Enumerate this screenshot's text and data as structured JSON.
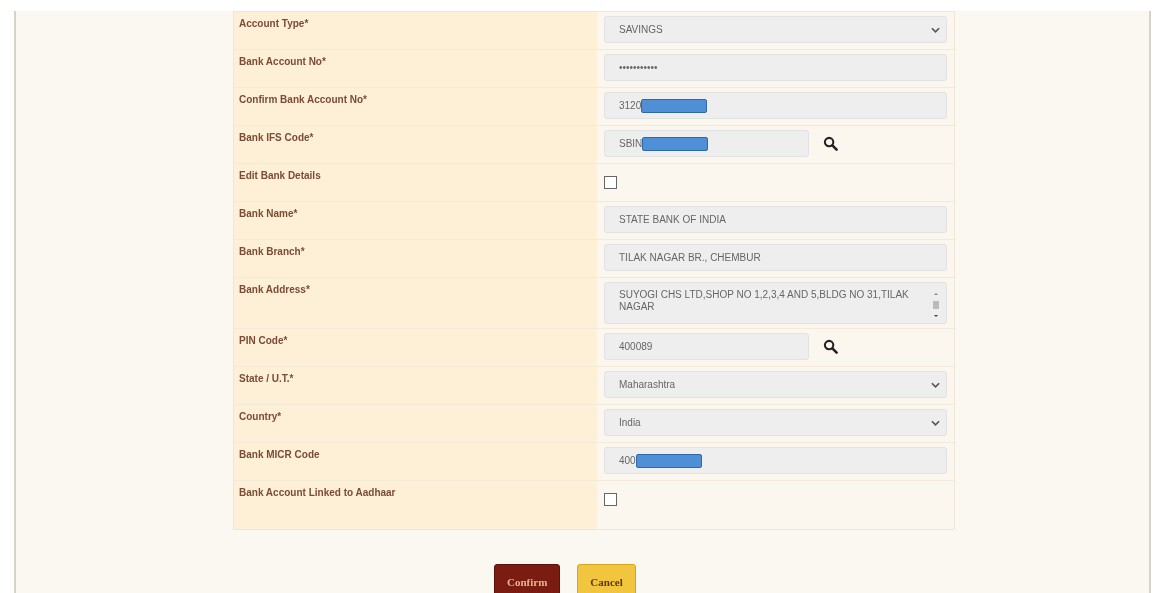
{
  "form": {
    "rows": [
      {
        "label": "Account Type*",
        "kind": "select",
        "value": "SAVINGS"
      },
      {
        "label": "Bank Account No*",
        "kind": "text",
        "value": "•••••••••••"
      },
      {
        "label": "Confirm Bank Account No*",
        "kind": "text",
        "value": "3120",
        "redacted": true
      },
      {
        "label": "Bank IFS Code*",
        "kind": "search",
        "value": "SBIN",
        "redacted": true
      },
      {
        "label": "Edit Bank Details",
        "kind": "checkbox",
        "checked": false
      },
      {
        "label": "Bank Name*",
        "kind": "text",
        "value": "STATE BANK OF INDIA"
      },
      {
        "label": "Bank Branch*",
        "kind": "text",
        "value": "TILAK NAGAR BR., CHEMBUR"
      },
      {
        "label": "Bank Address*",
        "kind": "textarea",
        "value": "SUYOGI CHS LTD,SHOP NO 1,2,3,4 AND 5,BLDG NO 31,TILAK NAGAR"
      },
      {
        "label": "PIN Code*",
        "kind": "search",
        "value": "400089"
      },
      {
        "label": "State / U.T.*",
        "kind": "select",
        "value": "Maharashtra"
      },
      {
        "label": "Country*",
        "kind": "select",
        "value": "India"
      },
      {
        "label": "Bank MICR Code",
        "kind": "text",
        "value": "400",
        "redacted": true
      },
      {
        "label": "Bank Account Linked to Aadhaar",
        "kind": "checkbox",
        "checked": false
      }
    ]
  },
  "buttons": [
    {
      "label": "Confirm",
      "kind": "primary"
    },
    {
      "label": "Cancel",
      "kind": "secondary"
    }
  ]
}
